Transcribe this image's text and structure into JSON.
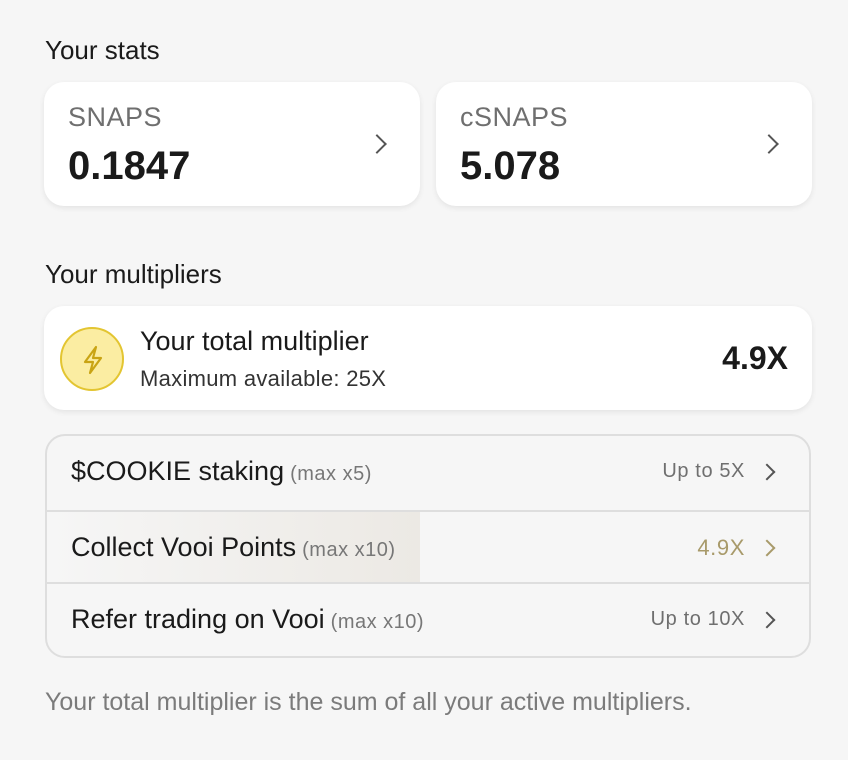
{
  "stats": {
    "title": "Your stats",
    "cards": [
      {
        "label": "SNAPS",
        "value": "0.1847"
      },
      {
        "label": "cSNAPS",
        "value": "5.078"
      }
    ]
  },
  "multipliers": {
    "title": "Your multipliers",
    "total": {
      "title": "Your total multiplier",
      "subtitle": "Maximum available: 25X",
      "value": "4.9X",
      "icon": "lightning-bolt-icon",
      "accent_color": "#e3c531"
    },
    "items": [
      {
        "label": "$COOKIE staking",
        "max": "(max x5)",
        "value": "Up to 5X",
        "progress": 0
      },
      {
        "label": "Collect Vooi Points",
        "max": "(max x10)",
        "value": "4.9X",
        "progress": 0.49,
        "active_color": "#a89a6a"
      },
      {
        "label": "Refer trading on Vooi",
        "max": "(max x10)",
        "value": "Up to 10X",
        "progress": 0
      }
    ],
    "footnote": "Your total multiplier is the sum of all your active multipliers."
  }
}
